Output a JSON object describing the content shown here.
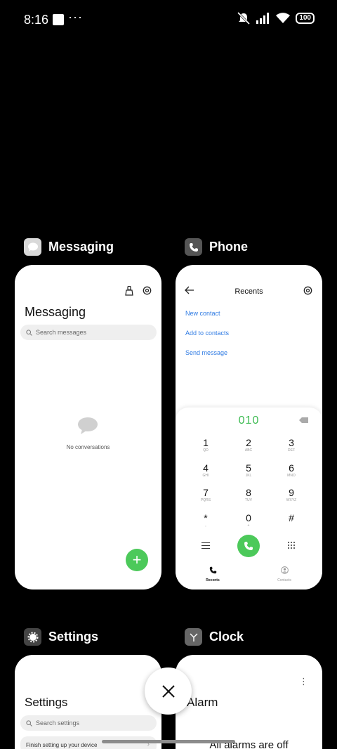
{
  "status_bar": {
    "time": "8:16",
    "dots": "···",
    "battery": "100"
  },
  "apps": [
    {
      "name": "Messaging",
      "icon": "messaging-icon",
      "content": {
        "title": "Messaging",
        "search_placeholder": "Search messages",
        "empty_text": "No conversations",
        "fab_label": "+"
      }
    },
    {
      "name": "Phone",
      "icon": "phone-icon",
      "content": {
        "title": "Recents",
        "links": [
          "New contact",
          "Add to contacts",
          "Send message"
        ],
        "dialed_number": "010",
        "keys": [
          {
            "d": "1",
            "l": "QD"
          },
          {
            "d": "2",
            "l": "ABC"
          },
          {
            "d": "3",
            "l": "DEF"
          },
          {
            "d": "4",
            "l": "GHI"
          },
          {
            "d": "5",
            "l": "JKL"
          },
          {
            "d": "6",
            "l": "MNO"
          },
          {
            "d": "7",
            "l": "PQRS"
          },
          {
            "d": "8",
            "l": "TUV"
          },
          {
            "d": "9",
            "l": "WXYZ"
          },
          {
            "d": "*",
            "l": ","
          },
          {
            "d": "0",
            "l": "+"
          },
          {
            "d": "#",
            "l": ""
          }
        ],
        "nav": [
          "Recents",
          "Contacts"
        ]
      }
    },
    {
      "name": "Settings",
      "icon": "settings-icon",
      "content": {
        "title": "Settings",
        "search_placeholder": "Search settings",
        "finish_setup": "Finish setting up your device"
      }
    },
    {
      "name": "Clock",
      "icon": "clock-icon",
      "content": {
        "title": "Alarm",
        "empty_text": "All alarms are off"
      }
    }
  ],
  "colors": {
    "accent_green": "#4cc95a",
    "link_blue": "#2f7be3",
    "background": "#000000"
  }
}
